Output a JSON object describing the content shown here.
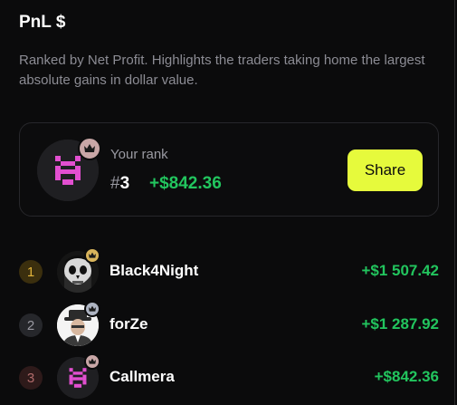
{
  "header": {
    "title": "PnL $",
    "description": "Ranked by Net Profit. Highlights the traders taking home the largest absolute gains in dollar value."
  },
  "your_rank": {
    "label": "Your rank",
    "hash": "#",
    "rank": "3",
    "amount": "+$842.36",
    "share_label": "Share",
    "avatar_icon": "pixel-h-logo-icon",
    "crown_icon": "crown-icon"
  },
  "leaderboard": [
    {
      "position": "1",
      "name": "Black4Night",
      "amount": "+$1 507.42",
      "badge_color": "#e0b23a",
      "badge_bg": "#3b2f0e",
      "crown_bg": "#d8b45c",
      "avatar_icon": "skull-avatar-icon"
    },
    {
      "position": "2",
      "name": "forZe",
      "amount": "+$1 287.92",
      "badge_color": "#9a9aa2",
      "badge_bg": "#26272b",
      "crown_bg": "#aeb4c2",
      "avatar_icon": "man-in-hat-avatar-icon"
    },
    {
      "position": "3",
      "name": "Callmera",
      "amount": "+$842.36",
      "badge_color": "#b06a6a",
      "badge_bg": "#2e1a1a",
      "crown_bg": "#c9a7a7",
      "avatar_icon": "pixel-h-logo-icon"
    }
  ],
  "colors": {
    "accent": "#e6fa3c",
    "profit": "#22c55e",
    "logo_pink": "#e24fd0",
    "background": "#0b0b0c"
  }
}
